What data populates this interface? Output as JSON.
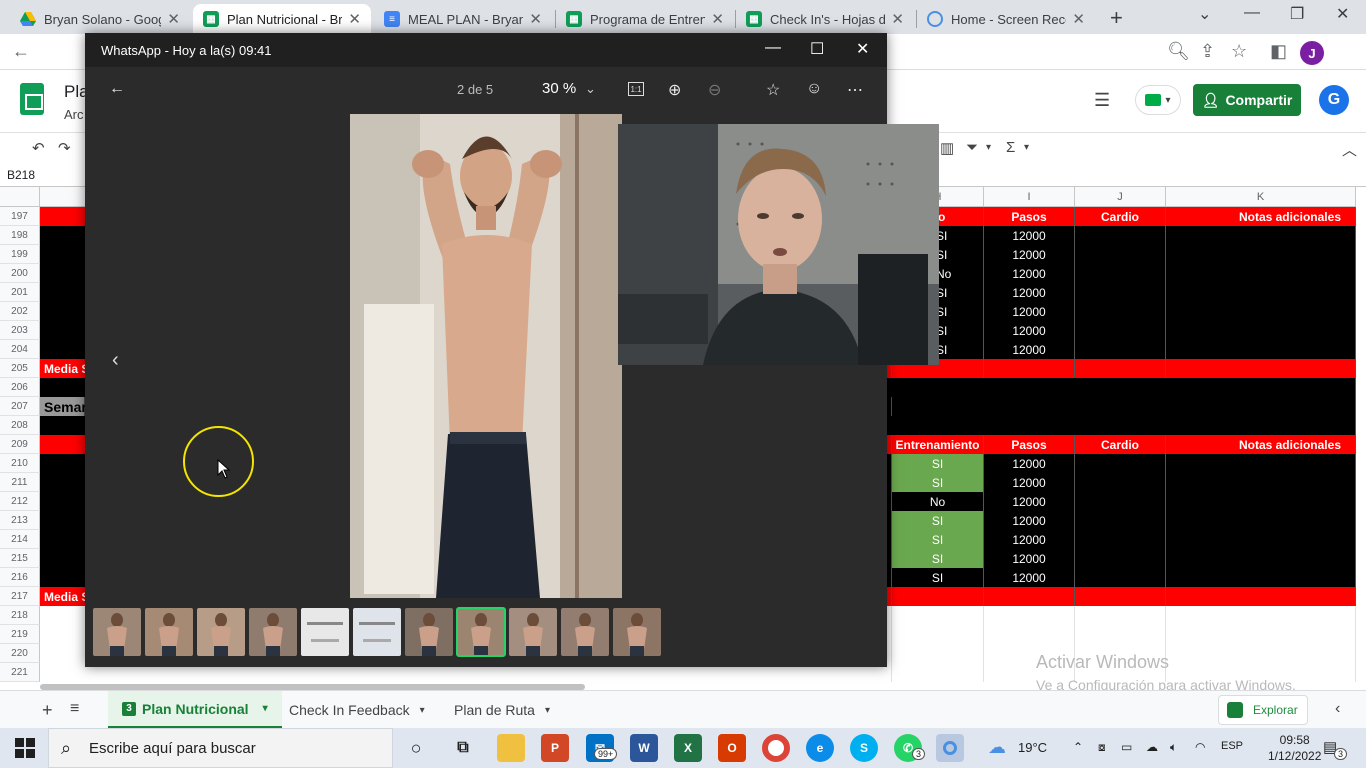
{
  "browser": {
    "tabs": [
      {
        "title": "Bryan Solano - Google",
        "color": "#fbbc04",
        "icon": "drive-icon"
      },
      {
        "title": "Plan Nutricional - Brya",
        "color": "#0f9d58",
        "icon": "sheets-icon"
      },
      {
        "title": "MEAL PLAN - Bryan S",
        "color": "#4285f4",
        "icon": "docs-icon"
      },
      {
        "title": "Programa de Entrenan",
        "color": "#0f9d58",
        "icon": "sheets-icon"
      },
      {
        "title": "Check In's - Hojas de",
        "color": "#0f9d58",
        "icon": "sheets-icon"
      },
      {
        "title": "Home - Screen Record",
        "color": "#4a90e2",
        "icon": "record-icon"
      }
    ],
    "profile_initial": "J"
  },
  "sheets": {
    "doc_title": "Pla",
    "doc_menu": "Arc",
    "share_label": "Compartir",
    "avatar_initial": "G",
    "namebox": "B218",
    "columns": [
      {
        "label": "H"
      },
      {
        "label": "I"
      },
      {
        "label": "J"
      },
      {
        "label": "K"
      }
    ],
    "rows": [
      {
        "num": "197",
        "kind": "header",
        "h": "namiento",
        "i": "Pasos",
        "j": "Cardio",
        "k": "Notas adicionales"
      },
      {
        "num": "198",
        "kind": "data",
        "h": "SI",
        "i": "12000"
      },
      {
        "num": "199",
        "kind": "data",
        "h": "SI",
        "i": "12000"
      },
      {
        "num": "200",
        "kind": "data",
        "h": "No",
        "i": "12000"
      },
      {
        "num": "201",
        "kind": "data",
        "h": "SI",
        "i": "12000"
      },
      {
        "num": "202",
        "kind": "data",
        "h": "SI",
        "i": "12000"
      },
      {
        "num": "203",
        "kind": "data",
        "h": "SI",
        "i": "12000"
      },
      {
        "num": "204",
        "kind": "data",
        "h": "SI",
        "i": "12000"
      },
      {
        "num": "205",
        "kind": "media",
        "label": "Media S"
      },
      {
        "num": "206",
        "kind": "black"
      },
      {
        "num": "207",
        "kind": "week",
        "label": "Semar"
      },
      {
        "num": "208",
        "kind": "black"
      },
      {
        "num": "209",
        "kind": "header2",
        "h": "Entrenamiento",
        "i": "Pasos",
        "j": "Cardio",
        "k": "Notas adicionales"
      },
      {
        "num": "210",
        "kind": "data2",
        "h": "SI",
        "i": "12000"
      },
      {
        "num": "211",
        "kind": "data2",
        "h": "SI",
        "i": "12000"
      },
      {
        "num": "212",
        "kind": "data2b",
        "h": "No",
        "i": "12000"
      },
      {
        "num": "213",
        "kind": "data2",
        "h": "SI",
        "i": "12000"
      },
      {
        "num": "214",
        "kind": "data2",
        "h": "SI",
        "i": "12000"
      },
      {
        "num": "215",
        "kind": "data2",
        "h": "SI",
        "i": "12000"
      },
      {
        "num": "216",
        "kind": "data2b",
        "h": "SI",
        "i": "12000"
      },
      {
        "num": "217",
        "kind": "media",
        "label": "Media S"
      },
      {
        "num": "218",
        "kind": "empty"
      },
      {
        "num": "219",
        "kind": "empty"
      },
      {
        "num": "220",
        "kind": "empty"
      },
      {
        "num": "221",
        "kind": "empty"
      }
    ],
    "sheet_tabs": [
      {
        "label": "Plan Nutricional",
        "active": true
      },
      {
        "label": "Check In Feedback",
        "active": false
      },
      {
        "label": "Plan de Ruta",
        "active": false
      }
    ],
    "explore_label": "Explorar"
  },
  "watermark": {
    "title": "Activar Windows",
    "subtitle": "Ve a Configuración para activar Windows."
  },
  "whatsapp": {
    "window_title": "WhatsApp - Hoy a la(s) 09:41",
    "counter": "2 de 5",
    "zoom": "30 %",
    "thumbnail_count": 11,
    "selected_thumbnail": 8
  },
  "taskbar": {
    "search_placeholder": "Escribe aquí para buscar",
    "mail_badge": "99+",
    "whatsapp_badge": "3",
    "weather": "19°C",
    "language": "ESP",
    "time": "09:58",
    "date": "1/12/2022",
    "notifications": "3"
  }
}
